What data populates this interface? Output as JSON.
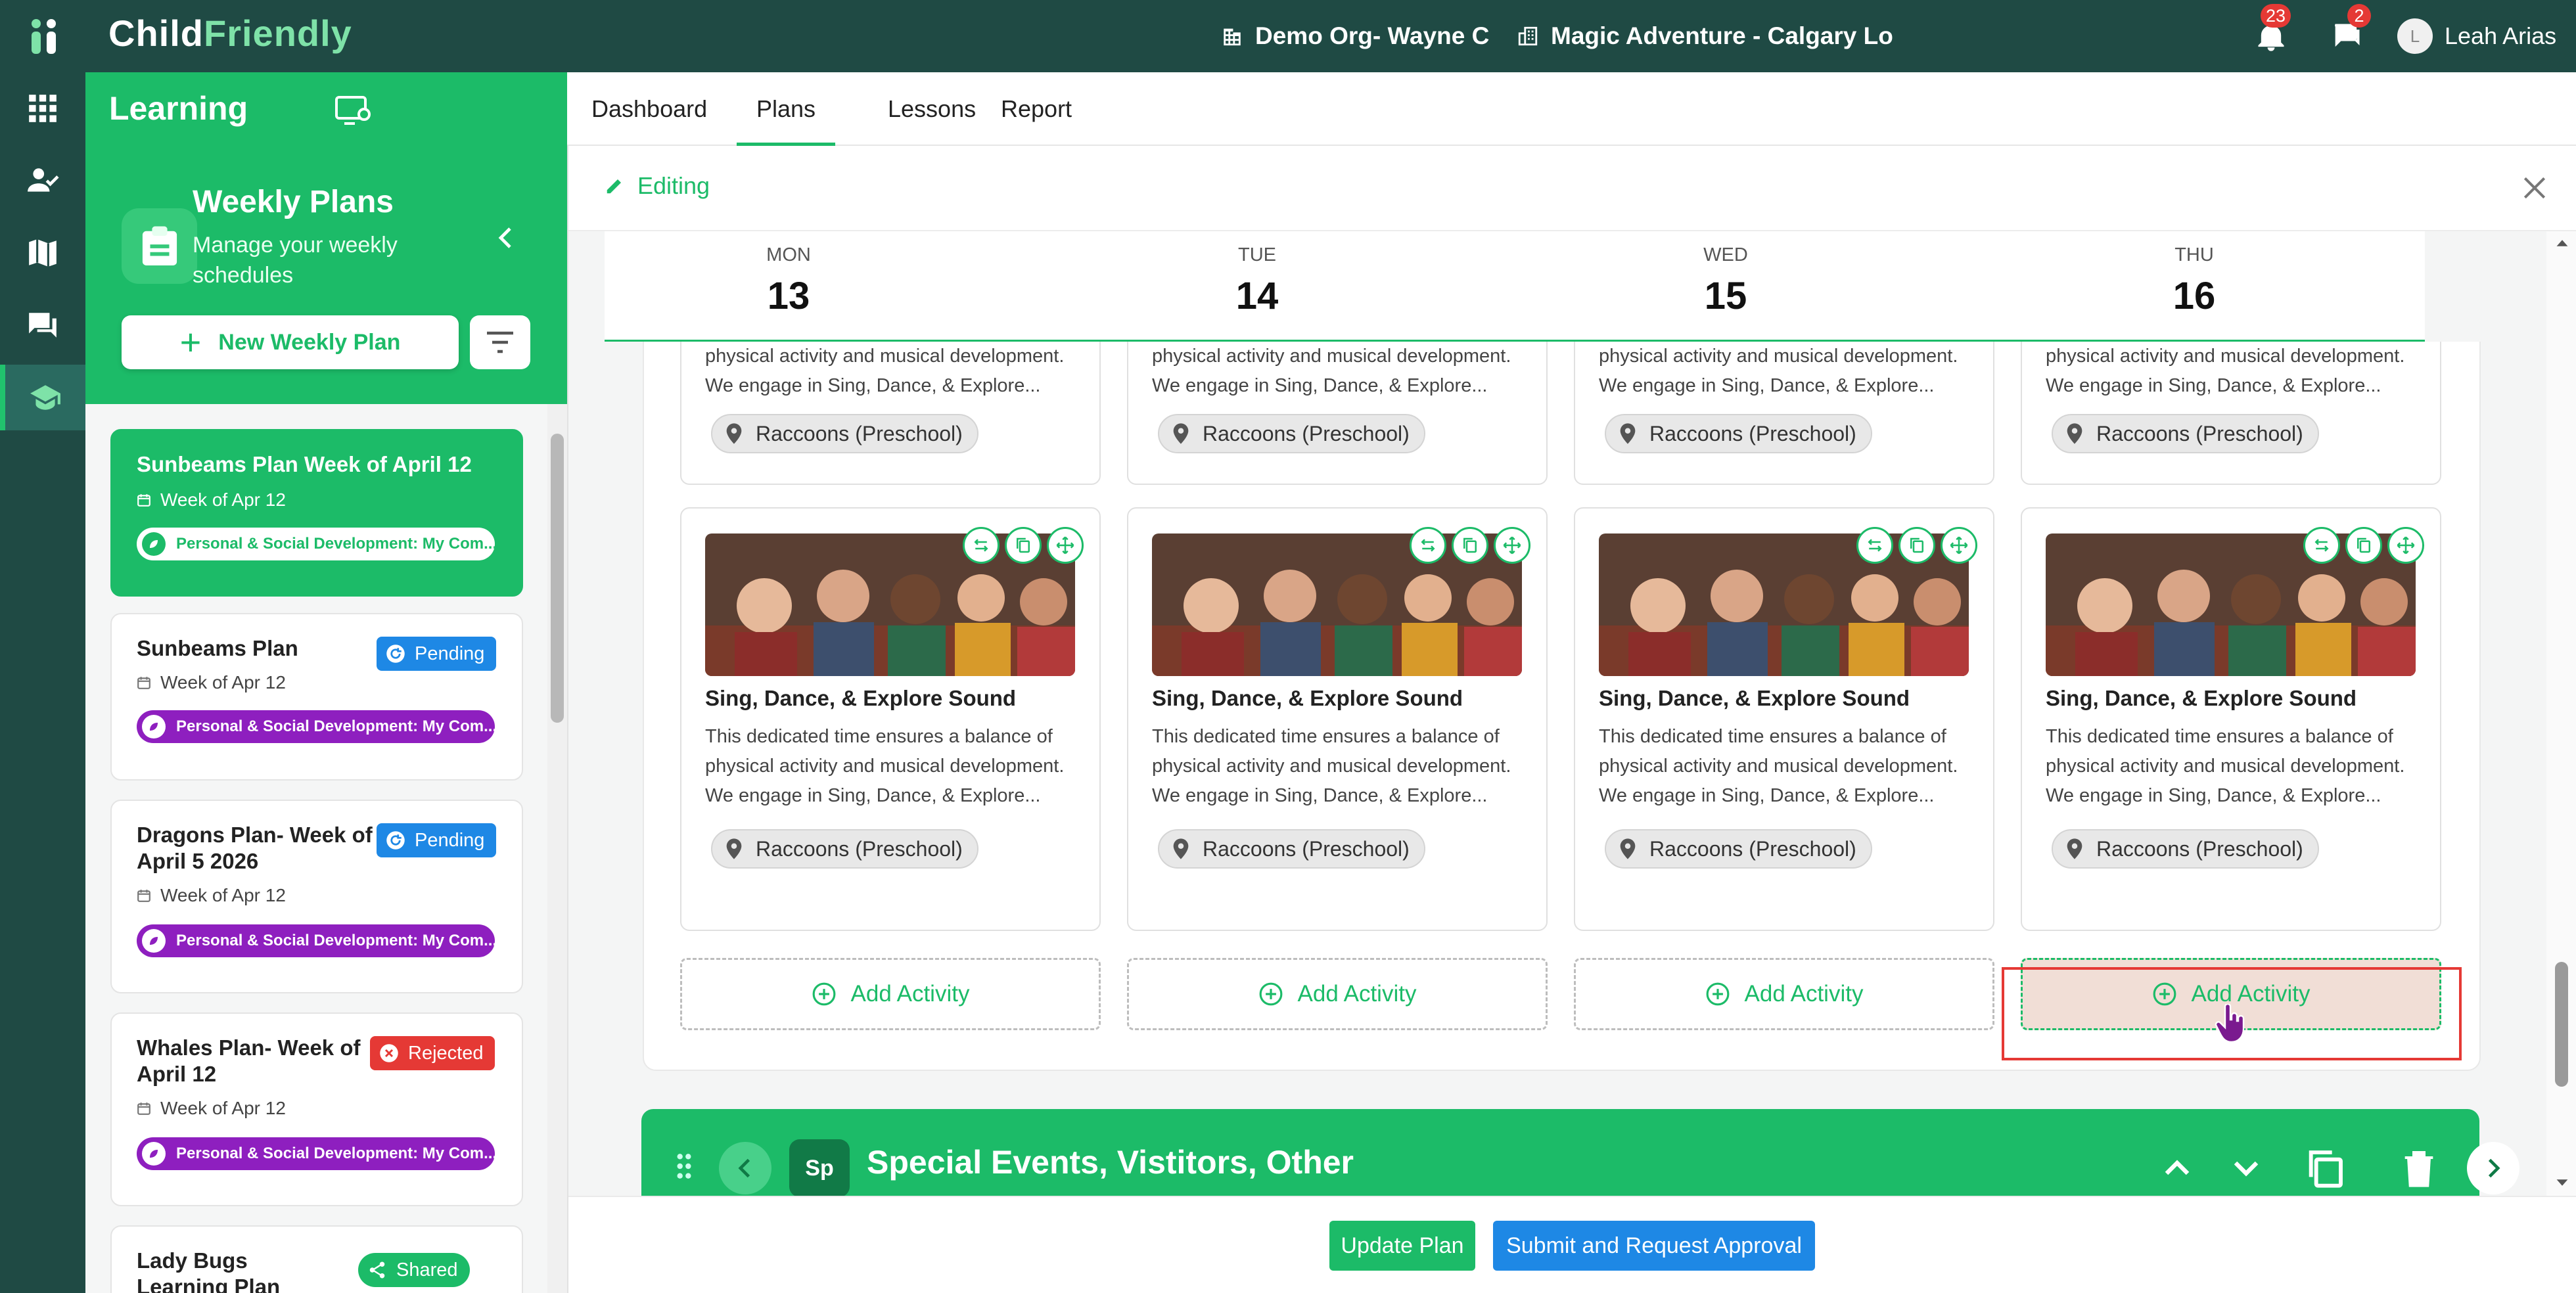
{
  "app": {
    "brand_prefix": "Child",
    "brand_suffix": "Friendly",
    "org": "Demo Org- Wayne C",
    "center": "Magic Adventure - Calgary Lo",
    "notifications_count": "23",
    "messages_count": "2",
    "user_initial": "L",
    "user_name": "Leah Arias"
  },
  "module": {
    "title": "Learning",
    "tabs": [
      "Dashboard",
      "Plans",
      "Lessons",
      "Report"
    ],
    "active_tab": "Plans"
  },
  "panel": {
    "title": "Weekly Plans",
    "subtitle": "Manage your weekly schedules",
    "new_plan_label": "New Weekly Plan",
    "plans": [
      {
        "title": "Sunbeams Plan Week of April 12",
        "week": "Week of Apr 12",
        "tag": "Personal & Social Development: My Com...",
        "status": "",
        "active": true
      },
      {
        "title": "Sunbeams Plan",
        "week": "Week of Apr 12",
        "tag": "Personal & Social Development: My Com...",
        "status": "Pending"
      },
      {
        "title": "Dragons Plan- Week of April 5 2026",
        "week": "Week of Apr 12",
        "tag": "Personal & Social Development: My Com...",
        "status": "Pending"
      },
      {
        "title": "Whales Plan- Week of April 12",
        "week": "Week of Apr 12",
        "tag": "Personal & Social Development: My Com...",
        "status": "Rejected"
      },
      {
        "title": "Lady Bugs Learning Plan",
        "week": "",
        "tag": "",
        "status": "Shared"
      }
    ]
  },
  "editor": {
    "mode_label": "Editing",
    "days": [
      {
        "name": "MON",
        "num": "13"
      },
      {
        "name": "TUE",
        "num": "14"
      },
      {
        "name": "WED",
        "num": "15"
      },
      {
        "name": "THU",
        "num": "16"
      }
    ],
    "top_card_text_line1": "physical activity and musical development.",
    "top_card_text_line2": "We engage in Sing, Dance, & Explore...",
    "location": "Raccoons (Preschool)",
    "activity_title": "Sing, Dance, & Explore Sound",
    "activity_desc_line1": "This dedicated time ensures a balance of",
    "activity_desc_line2": "physical activity and musical development.",
    "activity_desc_line3": "We engage in Sing, Dance, & Explore...",
    "add_activity_label": "Add Activity",
    "section_badge": "Sp",
    "section_title": "Special Events, Vistitors, Other",
    "update_label": "Update Plan",
    "submit_label": "Submit and Request Approval"
  },
  "colors": {
    "topbar": "#1f4a44",
    "accent": "#1cbb68",
    "pending": "#1e88e5",
    "rejected": "#e53935",
    "tag": "#8e1fbf"
  }
}
